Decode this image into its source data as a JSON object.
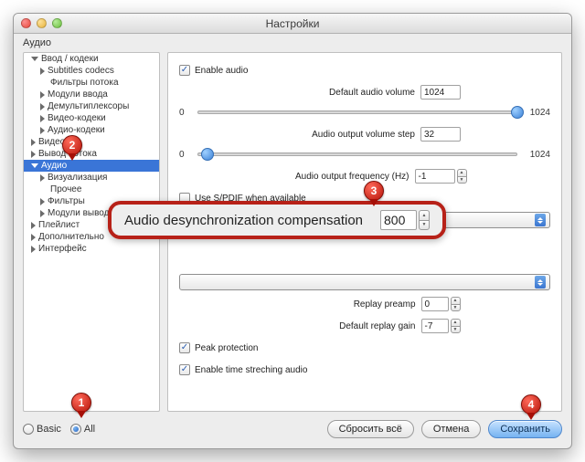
{
  "window": {
    "title": "Настройки"
  },
  "section": "Аудио",
  "sidebar": {
    "items": [
      {
        "label": "Ввод / кодеки",
        "level": 0,
        "state": "open"
      },
      {
        "label": "Subtitles codecs",
        "level": 1,
        "state": "closed"
      },
      {
        "label": "Фильтры потока",
        "level": 1,
        "state": "none"
      },
      {
        "label": "Модули ввода",
        "level": 1,
        "state": "closed"
      },
      {
        "label": "Демультиплексоры",
        "level": 1,
        "state": "closed"
      },
      {
        "label": "Видео-кодеки",
        "level": 1,
        "state": "closed"
      },
      {
        "label": "Аудио-кодеки",
        "level": 1,
        "state": "closed"
      },
      {
        "label": "Видео",
        "level": 0,
        "state": "closed"
      },
      {
        "label": "Вывод потока",
        "level": 0,
        "state": "closed"
      },
      {
        "label": "Аудио",
        "level": 0,
        "state": "open",
        "selected": true
      },
      {
        "label": "Визуализация",
        "level": 1,
        "state": "closed"
      },
      {
        "label": "Прочее",
        "level": 1,
        "state": "none"
      },
      {
        "label": "Фильтры",
        "level": 1,
        "state": "closed"
      },
      {
        "label": "Модули вывода",
        "level": 1,
        "state": "closed"
      },
      {
        "label": "Плейлист",
        "level": 0,
        "state": "closed"
      },
      {
        "label": "Дополнительно",
        "level": 0,
        "state": "closed"
      },
      {
        "label": "Интерфейс",
        "level": 0,
        "state": "closed"
      }
    ]
  },
  "content": {
    "enable_audio": {
      "label": "Enable audio",
      "checked": true
    },
    "default_volume": {
      "label": "Default audio volume",
      "value": "1024"
    },
    "volume_slider": {
      "min": "0",
      "max": "1024",
      "pos": 1.0
    },
    "output_step": {
      "label": "Audio output volume step",
      "value": "32"
    },
    "step_slider": {
      "min": "0",
      "max": "1024",
      "pos": 0.03
    },
    "output_freq": {
      "label": "Audio output frequency (Hz)",
      "value": "-1"
    },
    "spdif": {
      "label": "Use S/PDIF when available",
      "checked": false
    },
    "replay_preamp": {
      "label": "Replay preamp",
      "value": "0"
    },
    "default_replay_gain": {
      "label": "Default replay gain",
      "value": "-7"
    },
    "peak_protection": {
      "label": "Peak protection",
      "checked": true
    },
    "time_stretch": {
      "label": "Enable time streching audio",
      "checked": true
    }
  },
  "callout": {
    "label": "Audio desynchronization compensation",
    "value": "800"
  },
  "footer": {
    "basic": "Basic",
    "all": "All",
    "reset": "Сбросить всё",
    "cancel": "Отмена",
    "save": "Сохранить"
  },
  "markers": {
    "m1": "1",
    "m2": "2",
    "m3": "3",
    "m4": "4"
  }
}
